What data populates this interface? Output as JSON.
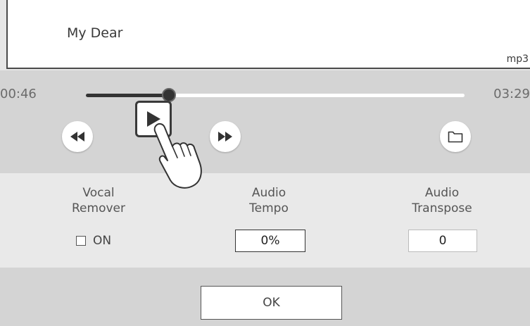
{
  "song": {
    "title": "My Dear",
    "format": "mp3"
  },
  "player": {
    "current_time": "00:46",
    "total_time": "03:29",
    "progress_fraction": 0.22,
    "controls": [
      "rewind-icon",
      "play-icon",
      "fast-forward-icon",
      "folder-icon"
    ]
  },
  "settings": {
    "vocal_remover": {
      "label_line1": "Vocal",
      "label_line2": "Remover",
      "checkbox_label": "ON",
      "checked": false
    },
    "audio_tempo": {
      "label_line1": "Audio",
      "label_line2": "Tempo",
      "value": "0%"
    },
    "audio_transpose": {
      "label_line1": "Audio",
      "label_line2": "Transpose",
      "value": "0"
    }
  },
  "ok_label": "OK",
  "colors": {
    "dark": "#333333",
    "panel": "#d4d4d4",
    "light_panel": "#e9e9e9",
    "track": "#ffffff"
  }
}
